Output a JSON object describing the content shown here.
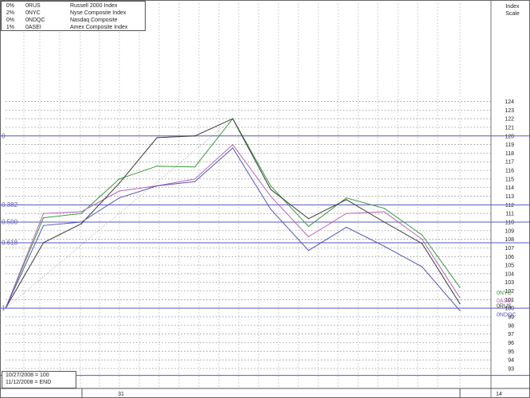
{
  "legend": [
    {
      "pct": "0%",
      "symbol": "0RUS",
      "name": "Russell 2000 Index"
    },
    {
      "pct": "2%",
      "symbol": "0NYC",
      "name": "Nyse Composite Index"
    },
    {
      "pct": "0%",
      "symbol": "0NDQC",
      "name": "Nasdaq Composite"
    },
    {
      "pct": "1%",
      "symbol": "0ASEI",
      "name": "Amex Composite Index"
    }
  ],
  "scale_title": [
    "Index",
    "Scale"
  ],
  "notes": [
    "10/27/2008 = 100",
    "11/12/2008 = END"
  ],
  "chart_data": {
    "type": "line",
    "x_tick_labels": [
      "31",
      "14"
    ],
    "y_ticks": [
      93,
      94,
      95,
      96,
      97,
      98,
      99,
      100,
      101,
      102,
      103,
      104,
      105,
      106,
      107,
      108,
      109,
      110,
      111,
      112,
      113,
      114,
      115,
      116,
      117,
      118,
      119,
      120,
      121,
      122,
      123,
      124
    ],
    "ylim": [
      92,
      125
    ],
    "fib_levels": [
      {
        "label": "0",
        "value": 120
      },
      {
        "label": "0.382",
        "value": 112
      },
      {
        "label": "0.500",
        "value": 110
      },
      {
        "label": "0.618",
        "value": 107.6
      },
      {
        "label": "1",
        "value": 100
      },
      {
        "label": "1.27",
        "value": 92.2
      }
    ],
    "series": [
      {
        "name": "0NYC",
        "color": "#3a9a3a",
        "label_value": 101.8,
        "values": [
          100,
          110.5,
          111,
          115,
          116.5,
          116.4,
          122,
          114.2,
          109.5,
          112.8,
          111.6,
          108.5,
          102.4
        ]
      },
      {
        "name": "0ASEI",
        "color": "#b565b5",
        "label_value": 100.9,
        "values": [
          100,
          111,
          111.2,
          113.6,
          114.2,
          115,
          119,
          113,
          108.3,
          111,
          111.2,
          108,
          101.2
        ]
      },
      {
        "name": "0RUS",
        "color": "#3a3a3a",
        "label_value": 100.3,
        "values": [
          100,
          107.6,
          109.8,
          114.5,
          119.8,
          120,
          122,
          113.8,
          110.4,
          112.6,
          110,
          107.5,
          100.5
        ]
      },
      {
        "name": "0NDQC",
        "color": "#5555bb",
        "label_value": 99.3,
        "values": [
          100,
          109.6,
          110,
          112.8,
          114.2,
          114.7,
          118.6,
          111.5,
          106.7,
          109.4,
          107.2,
          104.8,
          99.7
        ]
      }
    ]
  }
}
